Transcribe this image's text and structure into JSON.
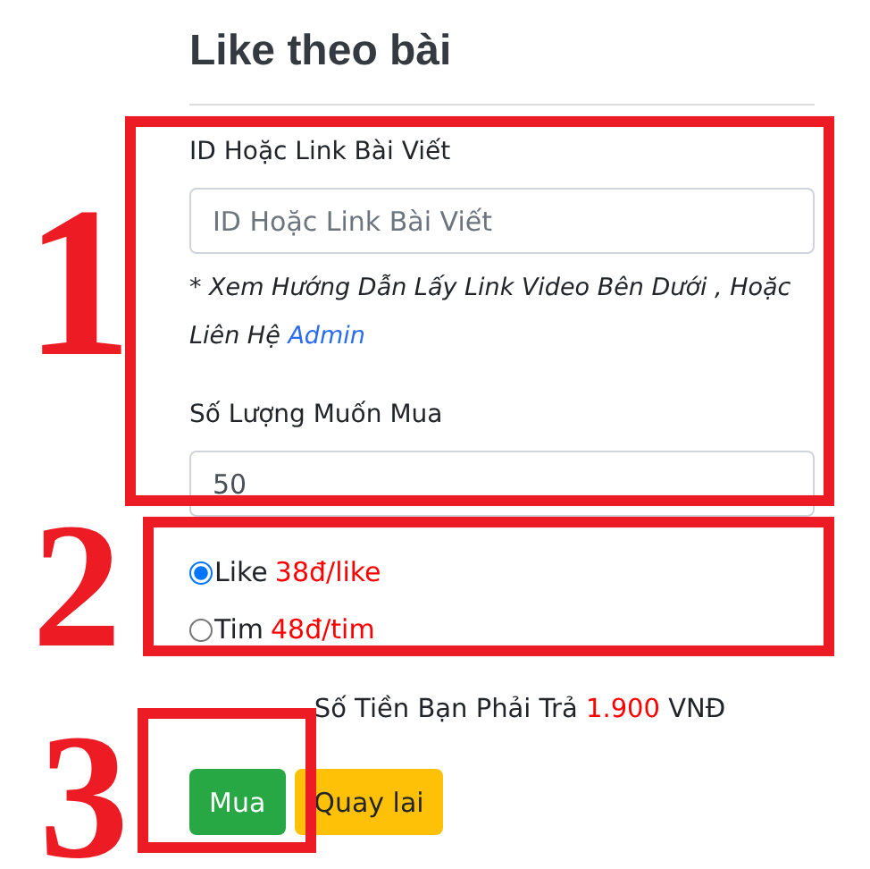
{
  "title": "Like theo bài",
  "link_field": {
    "label": "ID Hoặc Link Bài Viết",
    "placeholder": "ID Hoặc Link Bài Viết"
  },
  "hint": {
    "text": "* Xem Hướng Dẫn Lấy Link Video Bên Dưới , Hoặc Liên Hệ",
    "link": "Admin"
  },
  "quantity_field": {
    "label": "Số Lượng Muốn Mua",
    "value": "50"
  },
  "options": [
    {
      "label": "Like",
      "price": "38đ/like",
      "selected": true
    },
    {
      "label": "Tim",
      "price": "48đ/tim",
      "selected": false
    }
  ],
  "total": {
    "label": "Số Tiền Bạn Phải Trả",
    "amount": "1.900",
    "unit": "VNĐ"
  },
  "buttons": [
    {
      "label": "Mua",
      "kind": "primary"
    },
    {
      "label": "Quay lai",
      "kind": "secondary"
    }
  ],
  "annotations": [
    {
      "number": "1"
    },
    {
      "number": "2"
    },
    {
      "number": "3"
    }
  ]
}
